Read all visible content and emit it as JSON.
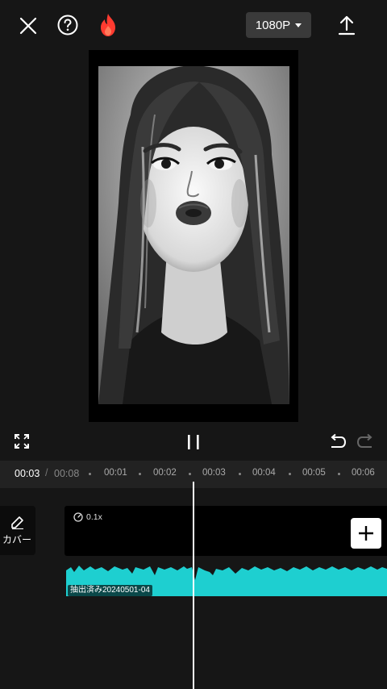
{
  "topbar": {
    "close_icon": "close-icon",
    "help_icon": "help-icon",
    "promo_icon": "fire-icon",
    "resolution": "1080P",
    "export_icon": "upload-icon"
  },
  "preview": {
    "content": "grayscale-portrait-photo",
    "frame_color": "#000000"
  },
  "controls": {
    "fullscreen_icon": "fullscreen-icon",
    "play_state": "pause-icon",
    "undo_icon": "undo-icon",
    "redo_icon": "redo-icon"
  },
  "timeline": {
    "current_time": "00:03",
    "separator": "/",
    "total_time": "00:08",
    "ticks": [
      "00:01",
      "00:02",
      "00:03",
      "00:04",
      "00:05",
      "00:06"
    ]
  },
  "tracks": {
    "cover_label": "カバー",
    "speed_label": "0.1x",
    "audio_label": "抽出済み20240501-04",
    "audio_color": "#1ecfd0",
    "add_icon": "plus-icon"
  }
}
